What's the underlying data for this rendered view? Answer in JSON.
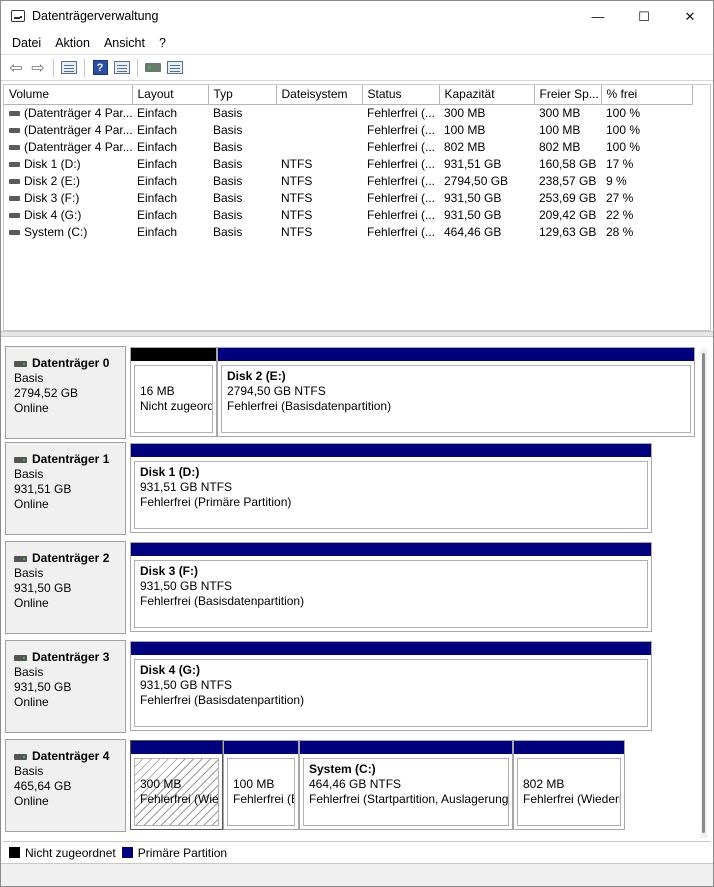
{
  "window": {
    "title": "Datenträgerverwaltung",
    "minimize": "—",
    "maximize": "☐",
    "close": "✕"
  },
  "menu": [
    "Datei",
    "Aktion",
    "Ansicht",
    "?"
  ],
  "toolbar": {
    "back": "⇦",
    "forward": "⇨",
    "help": "?"
  },
  "volume_table": {
    "headers": [
      "Volume",
      "Layout",
      "Typ",
      "Dateisystem",
      "Status",
      "Kapazität",
      "Freier Sp...",
      "% frei"
    ],
    "rows": [
      [
        "(Datenträger 4 Par...",
        "Einfach",
        "Basis",
        "",
        "Fehlerfrei (...",
        "300 MB",
        "300 MB",
        "100 %"
      ],
      [
        "(Datenträger 4 Par...",
        "Einfach",
        "Basis",
        "",
        "Fehlerfrei (...",
        "100 MB",
        "100 MB",
        "100 %"
      ],
      [
        "(Datenträger 4 Par...",
        "Einfach",
        "Basis",
        "",
        "Fehlerfrei (...",
        "802 MB",
        "802 MB",
        "100 %"
      ],
      [
        "Disk 1 (D:)",
        "Einfach",
        "Basis",
        "NTFS",
        "Fehlerfrei (...",
        "931,51 GB",
        "160,58 GB",
        "17 %"
      ],
      [
        "Disk 2 (E:)",
        "Einfach",
        "Basis",
        "NTFS",
        "Fehlerfrei (...",
        "2794,50 GB",
        "238,57 GB",
        "9 %"
      ],
      [
        "Disk 3 (F:)",
        "Einfach",
        "Basis",
        "NTFS",
        "Fehlerfrei (...",
        "931,50 GB",
        "253,69 GB",
        "27 %"
      ],
      [
        "Disk 4 (G:)",
        "Einfach",
        "Basis",
        "NTFS",
        "Fehlerfrei (...",
        "931,50 GB",
        "209,42 GB",
        "22 %"
      ],
      [
        "System (C:)",
        "Einfach",
        "Basis",
        "NTFS",
        "Fehlerfrei (...",
        "464,46 GB",
        "129,63 GB",
        "28 %"
      ]
    ]
  },
  "disks": [
    {
      "name": "Datenträger 0",
      "type": "Basis",
      "size": "2794,52 GB",
      "status": "Online",
      "partitions": [
        {
          "kind": "unalloc",
          "title": "",
          "line1": "16 MB",
          "line2": "Nicht zugeordnet"
        },
        {
          "kind": "prim",
          "title": "Disk 2  (E:)",
          "line1": "2794,50 GB NTFS",
          "line2": "Fehlerfrei (Basisdatenpartition)"
        }
      ]
    },
    {
      "name": "Datenträger 1",
      "type": "Basis",
      "size": "931,51 GB",
      "status": "Online",
      "partitions": [
        {
          "kind": "prim",
          "title": "Disk 1  (D:)",
          "line1": "931,51 GB NTFS",
          "line2": "Fehlerfrei (Primäre Partition)"
        }
      ]
    },
    {
      "name": "Datenträger 2",
      "type": "Basis",
      "size": "931,50 GB",
      "status": "Online",
      "partitions": [
        {
          "kind": "prim",
          "title": "Disk 3  (F:)",
          "line1": "931,50 GB NTFS",
          "line2": "Fehlerfrei (Basisdatenpartition)"
        }
      ]
    },
    {
      "name": "Datenträger 3",
      "type": "Basis",
      "size": "931,50 GB",
      "status": "Online",
      "partitions": [
        {
          "kind": "prim",
          "title": "Disk 4  (G:)",
          "line1": "931,50 GB NTFS",
          "line2": "Fehlerfrei (Basisdatenpartition)"
        }
      ]
    },
    {
      "name": "Datenträger 4",
      "type": "Basis",
      "size": "465,64 GB",
      "status": "Online",
      "partitions": [
        {
          "kind": "prim",
          "title": "",
          "line1": "300 MB",
          "line2": "Fehlerfrei (Wiederherstellungspartition)",
          "hatch": true
        },
        {
          "kind": "prim",
          "title": "",
          "line1": "100 MB",
          "line2": "Fehlerfrei (EFI-Systempartition)"
        },
        {
          "kind": "prim",
          "title": "System  (C:)",
          "line1": "464,46 GB NTFS",
          "line2": "Fehlerfrei (Startpartition, Auslagerungsdatei)"
        },
        {
          "kind": "prim",
          "title": "",
          "line1": "802 MB",
          "line2": "Fehlerfrei (Wiederherstellungspartition)"
        }
      ]
    }
  ],
  "legend": [
    {
      "label": "Nicht zugeordnet",
      "color": "#000000"
    },
    {
      "label": "Primäre Partition",
      "color": "#010180"
    }
  ]
}
